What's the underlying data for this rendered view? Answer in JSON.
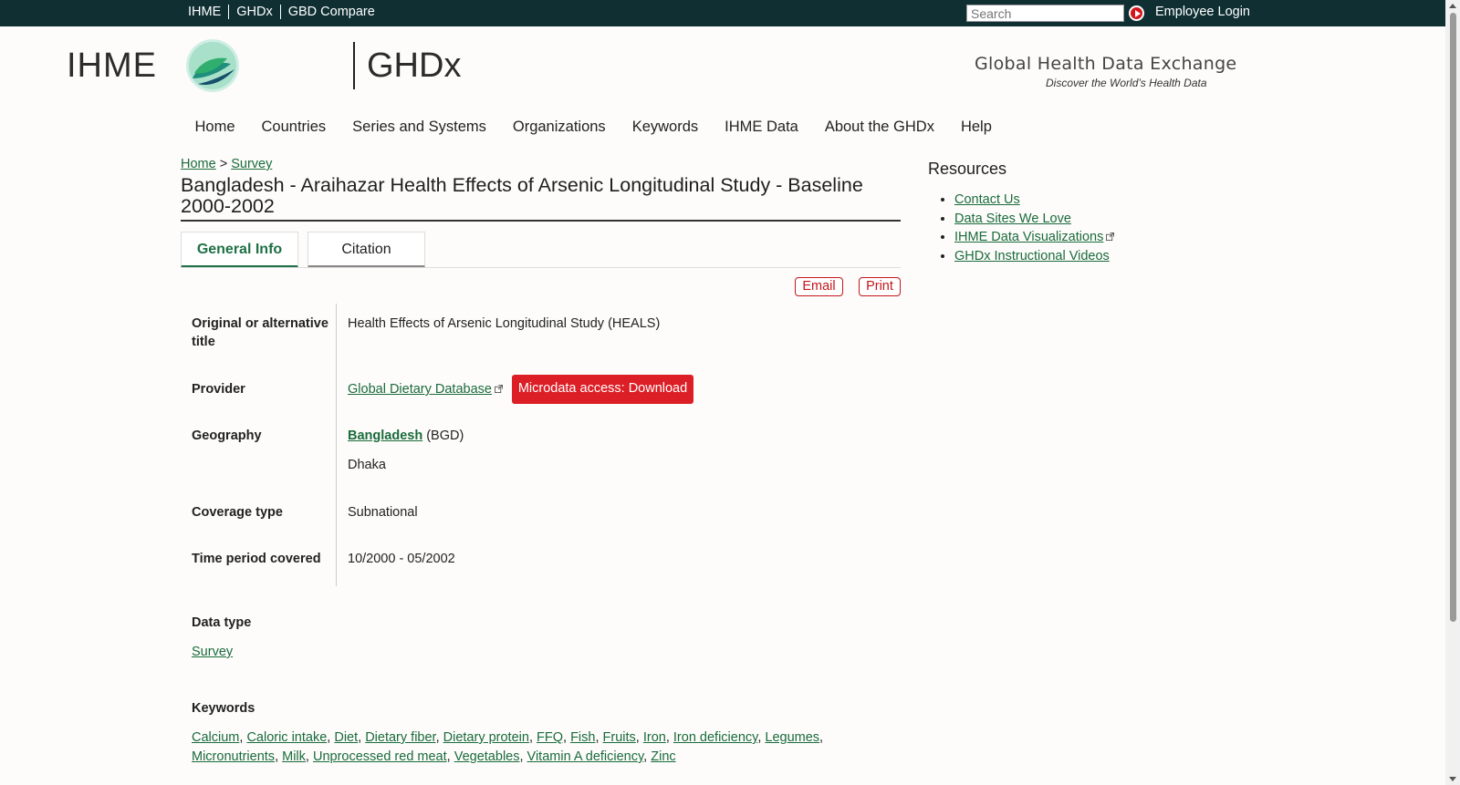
{
  "topbar": {
    "links": [
      "IHME",
      "GHDx",
      "GBD Compare"
    ],
    "search_placeholder": "Search",
    "login": "Employee Login"
  },
  "header": {
    "logo_left": "IHME",
    "logo_right": "GHDx",
    "tagline": "Global Health Data Exchange",
    "tagline_sub": "Discover the World’s Health Data"
  },
  "nav": [
    "Home",
    "Countries",
    "Series and Systems",
    "Organizations",
    "Keywords",
    "IHME Data",
    "About the GHDx",
    "Help"
  ],
  "breadcrumb": {
    "home": "Home",
    "sep": ">",
    "survey": "Survey"
  },
  "page_title": "Bangladesh - Araihazar Health Effects of Arsenic Longitudinal Study - Baseline 2000-2002",
  "tabs": {
    "general": "General Info",
    "citation": "Citation"
  },
  "actions": {
    "email": "Email",
    "print": "Print"
  },
  "info": {
    "alt_title_label": "Original or alternative title",
    "alt_title_value": "Health Effects of Arsenic Longitudinal Study (HEALS)",
    "provider_label": "Provider",
    "provider_value": "Global Dietary Database",
    "download_label": "Microdata access: Download",
    "geography_label": "Geography",
    "geography_country": "Bangladesh",
    "geography_code": "(BGD)",
    "geography_sub": "Dhaka",
    "coverage_label": "Coverage type",
    "coverage_value": "Subnational",
    "time_label": "Time period covered",
    "time_value": "10/2000 - 05/2002",
    "data_type_label": "Data type",
    "data_type_value": "Survey",
    "keywords_label": "Keywords"
  },
  "keywords": [
    "Calcium",
    "Caloric intake",
    "Diet",
    "Dietary fiber",
    "Dietary protein",
    "FFQ",
    "Fish",
    "Fruits",
    "Iron",
    "Iron deficiency",
    "Legumes",
    "Micronutrients",
    "Milk",
    "Unprocessed red meat",
    "Vegetables",
    "Vitamin A deficiency",
    "Zinc"
  ],
  "resources": {
    "title": "Resources",
    "items": [
      "Contact Us",
      "Data Sites We Love",
      "IHME Data Visualizations",
      "GHDx Instructional Videos"
    ]
  },
  "colors": {
    "topbar": "#0f2f33",
    "link": "#1a6b3a",
    "accent_red": "#dc1f26",
    "tab_active": "#1e7045"
  }
}
